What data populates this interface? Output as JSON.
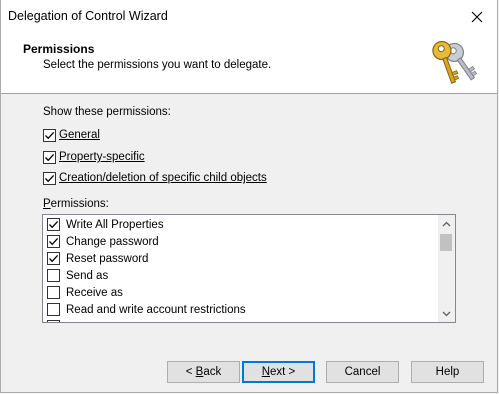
{
  "window": {
    "title": "Delegation of Control Wizard"
  },
  "header": {
    "title": "Permissions",
    "subtitle": "Select the permissions you want to delegate."
  },
  "show": {
    "label": "Show these permissions:",
    "options": [
      {
        "label": "General",
        "checked": true
      },
      {
        "label": "Property-specific",
        "checked": true
      },
      {
        "label": "Creation/deletion of specific child objects",
        "checked": true
      }
    ]
  },
  "permissions": {
    "label_mnemonic": "P",
    "label_rest": "ermissions:",
    "items": [
      {
        "label": "Write All Properties",
        "checked": true
      },
      {
        "label": "Change password",
        "checked": true
      },
      {
        "label": "Reset password",
        "checked": true
      },
      {
        "label": "Send as",
        "checked": false
      },
      {
        "label": "Receive as",
        "checked": false
      },
      {
        "label": "Read and write account restrictions",
        "checked": false
      }
    ]
  },
  "buttons": {
    "back_prefix": "< ",
    "back_mnemonic": "B",
    "back_rest": "ack",
    "next_mnemonic": "N",
    "next_rest": "ext >",
    "cancel": "Cancel",
    "help": "Help"
  },
  "icons": {
    "close": "close-icon",
    "keys": "keys-icon",
    "check": "check-icon",
    "scroll_up": "chevron-up-icon",
    "scroll_down": "chevron-down-icon"
  },
  "colors": {
    "accent": "#0078d7",
    "face": "#f0f0f0",
    "key_gold": "#d9a521",
    "key_silver": "#b8bcc4"
  }
}
